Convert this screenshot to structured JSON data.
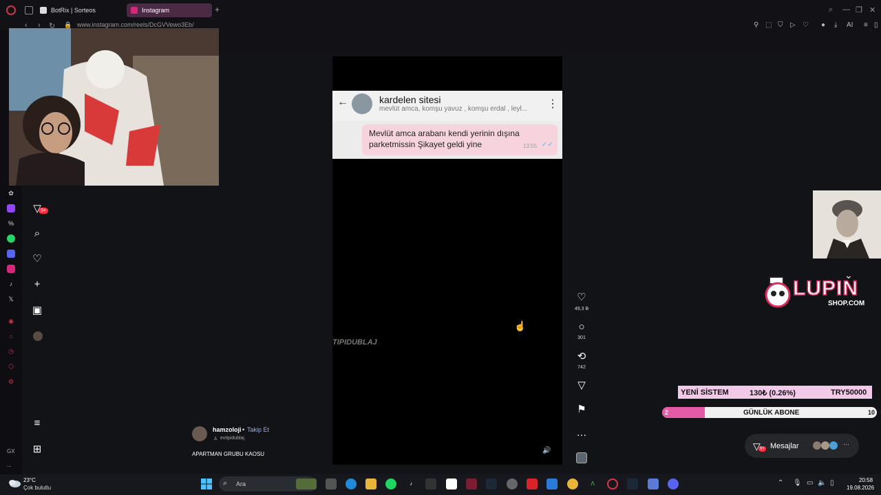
{
  "browser": {
    "tabs": [
      {
        "label": "BotRix | Sorteos",
        "active": false
      },
      {
        "label": "Instagram",
        "active": true
      }
    ],
    "new_tab": "+",
    "url": "www.instagram.com/reels/DcGVVewo3Eb/",
    "ai_label": "AI"
  },
  "opera_sidebar": {
    "gx_label": "GX",
    "more_label": "..."
  },
  "ig_nav": {
    "notifications_badge": "9+"
  },
  "reel": {
    "chat": {
      "group_name": "kardelen sitesi",
      "members": "mevlüt amca, komşu yavuz , komşu erdal , leyl...",
      "message": "Mevlüt amca arabanı kendi yerinin dışına parketmissin Şikayet geldi yine",
      "time": "13:55"
    },
    "watermark": "TIPIDUBLAJ",
    "likes": "49,3 B",
    "comments": "301",
    "reposts": "742",
    "author": {
      "username": "hamzoloji",
      "separator": "•",
      "follow_label": "Takip Et",
      "audio": "evtipidublaj"
    },
    "caption": "APARTMAN GRUBU KAOSU"
  },
  "overlays": {
    "lupin_title": "LUPIN",
    "lupin_sub": "SHOP.COM",
    "ticker": {
      "left": "YENİ SİSTEM",
      "middle": "130₺ (0.26%)",
      "right": "TRY50000"
    },
    "goal": {
      "start": "2",
      "label": "GÜNLÜK ABONE",
      "end": "10",
      "progress": 0.2
    },
    "messages": {
      "label": "Mesajlar",
      "badge": "9+"
    }
  },
  "taskbar": {
    "temperature": "23°C",
    "condition": "Çok bulutlu",
    "search_placeholder": "Ara",
    "time": "20:58",
    "date": "19.08.2026"
  },
  "colors": {
    "ig_badge": "#ff3040",
    "ticker_bg": "#f3c9ea",
    "goal_fill": "#e45aa6",
    "chat_bubble": "#f7d4dd",
    "lupin_pink": "#d92a5a"
  }
}
